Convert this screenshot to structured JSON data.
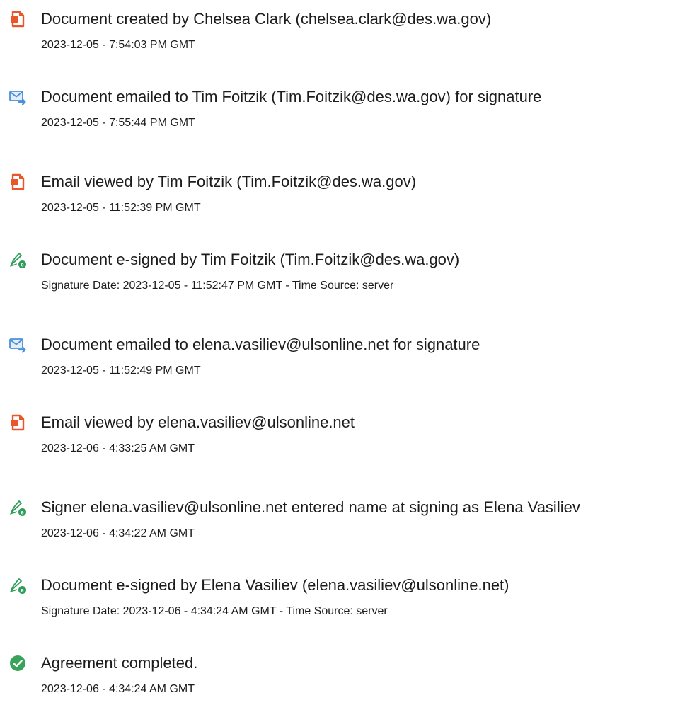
{
  "events": [
    {
      "icon": "document-created-icon",
      "title": "Document created by Chelsea Clark (chelsea.clark@des.wa.gov)",
      "detail": "2023-12-05 - 7:54:03 PM GMT"
    },
    {
      "icon": "email-sent-icon",
      "title": "Document emailed to Tim Foitzik (Tim.Foitzik@des.wa.gov) for signature",
      "detail": "2023-12-05 - 7:55:44 PM GMT"
    },
    {
      "icon": "document-viewed-icon",
      "title": "Email viewed by Tim Foitzik (Tim.Foitzik@des.wa.gov)",
      "detail": "2023-12-05 - 11:52:39 PM GMT"
    },
    {
      "icon": "e-sign-icon",
      "title": "Document e-signed by Tim Foitzik (Tim.Foitzik@des.wa.gov)",
      "detail": "Signature Date: 2023-12-05 - 11:52:47 PM GMT - Time Source: server"
    },
    {
      "icon": "email-sent-icon",
      "title": "Document emailed to elena.vasiliev@ulsonline.net for signature",
      "detail": "2023-12-05 - 11:52:49 PM GMT"
    },
    {
      "icon": "document-viewed-icon",
      "title": "Email viewed by elena.vasiliev@ulsonline.net",
      "detail": "2023-12-06 - 4:33:25 AM GMT"
    },
    {
      "icon": "e-sign-icon",
      "title": "Signer elena.vasiliev@ulsonline.net entered name at signing as Elena Vasiliev",
      "detail": "2023-12-06 - 4:34:22 AM GMT"
    },
    {
      "icon": "e-sign-icon",
      "title": "Document e-signed by Elena Vasiliev (elena.vasiliev@ulsonline.net)",
      "detail": "Signature Date: 2023-12-06 - 4:34:24 AM GMT - Time Source: server"
    },
    {
      "icon": "check-circle-icon",
      "title": "Agreement completed.",
      "detail": "2023-12-06 - 4:34:24 AM GMT"
    }
  ],
  "colors": {
    "document_icon": "#e8562a",
    "email_icon": "#4a90d9",
    "sign_icon": "#2e9c5a",
    "complete_icon": "#3aa35a"
  }
}
